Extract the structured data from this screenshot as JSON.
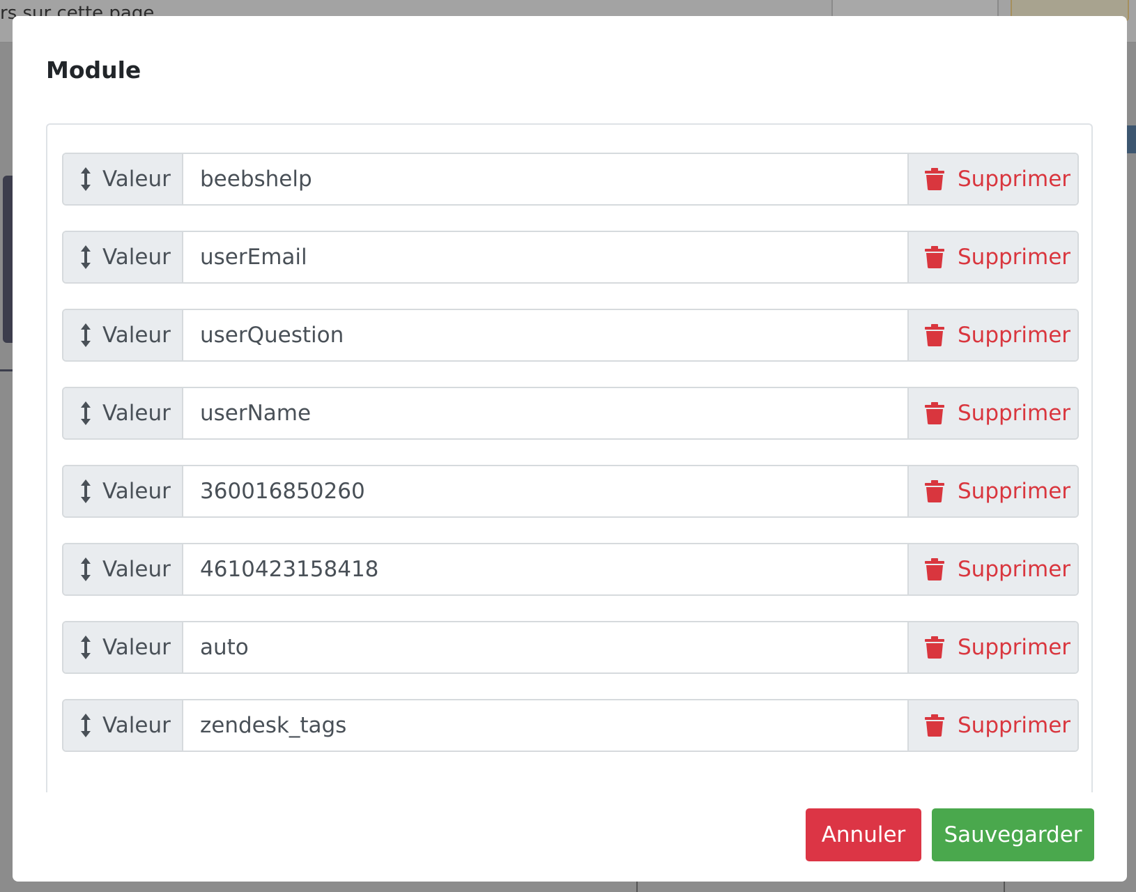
{
  "background": {
    "partial_text": "rs sur cette page"
  },
  "modal": {
    "title": "Module",
    "rows": [
      {
        "label": "Valeur",
        "value": "beebshelp",
        "delete_label": "Supprimer"
      },
      {
        "label": "Valeur",
        "value": "userEmail",
        "delete_label": "Supprimer"
      },
      {
        "label": "Valeur",
        "value": "userQuestion",
        "delete_label": "Supprimer"
      },
      {
        "label": "Valeur",
        "value": "userName",
        "delete_label": "Supprimer"
      },
      {
        "label": "Valeur",
        "value": "360016850260",
        "delete_label": "Supprimer"
      },
      {
        "label": "Valeur",
        "value": "4610423158418",
        "delete_label": "Supprimer"
      },
      {
        "label": "Valeur",
        "value": "auto",
        "delete_label": "Supprimer"
      },
      {
        "label": "Valeur",
        "value": "zendesk_tags",
        "delete_label": "Supprimer"
      }
    ],
    "cancel_label": "Annuler",
    "save_label": "Sauvegarder"
  },
  "icons": {
    "drag": "vertical-arrows-icon",
    "delete": "trash-icon"
  },
  "colors": {
    "danger": "#dc3545",
    "success": "#4aa84d",
    "delete_text": "#d9363e"
  }
}
